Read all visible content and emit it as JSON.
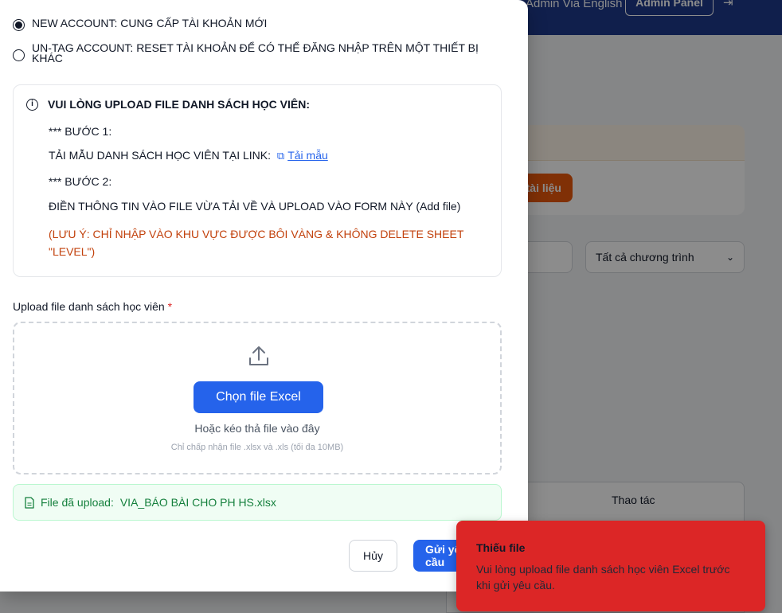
{
  "background": {
    "user_name": "Admin Via English",
    "admin_panel_label": "Admin Panel",
    "orange_button_label": "tài liệu",
    "program_select_value": "Tất cả chương trình",
    "table_header_actions": "Thao tác"
  },
  "modal": {
    "options": [
      {
        "label": "NEW ACCOUNT: CUNG CẤP TÀI KHOẢN MỚI",
        "selected": true
      },
      {
        "label": "UN-TAG ACCOUNT: RESET TÀI KHOẢN ĐỂ CÓ THỂ ĐĂNG NHẬP TRÊN MỘT THIẾT BỊ KHÁC",
        "selected": false
      }
    ],
    "info": {
      "title": "VUI LÒNG UPLOAD FILE DANH SÁCH HỌC VIÊN:",
      "step1_heading": "*** BƯỚC 1:",
      "step1_text": "TẢI MẪU DANH SÁCH HỌC VIÊN TẠI LINK:",
      "template_link": "Tải mẫu",
      "step2_heading": "*** BƯỚC 2:",
      "step2_text": "ĐIỀN THÔNG TIN VÀO FILE VỪA TẢI VỀ VÀ UPLOAD VÀO FORM NÀY (Add file)",
      "note": "(LƯU Ý: CHỈ NHẬP VÀO KHU VỰC ĐƯỢC BÔI VÀNG & KHÔNG DELETE SHEET \"LEVEL\")"
    },
    "upload": {
      "label": "Upload file danh sách học viên",
      "required_mark": "*",
      "choose_button": "Chọn file Excel",
      "drag_text": "Hoặc kéo thả file vào đây",
      "hint": "Chỉ chấp nhận file .xlsx và .xls (tối đa 10MB)"
    },
    "uploaded": {
      "prefix": "File đã upload:",
      "filename": "VIA_BÁO BÀI CHO PH HS.xlsx"
    },
    "cancel_button": "Hủy",
    "send_button": "Gửi yêu cầu"
  },
  "toast": {
    "title": "Thiếu file",
    "message": "Vui lòng upload file danh sách học viên Excel trước khi gửi yêu cầu."
  },
  "colors": {
    "primary": "#2563eb",
    "danger": "#dc2626",
    "warning_text": "#c2410c",
    "success_text": "#15803d"
  }
}
